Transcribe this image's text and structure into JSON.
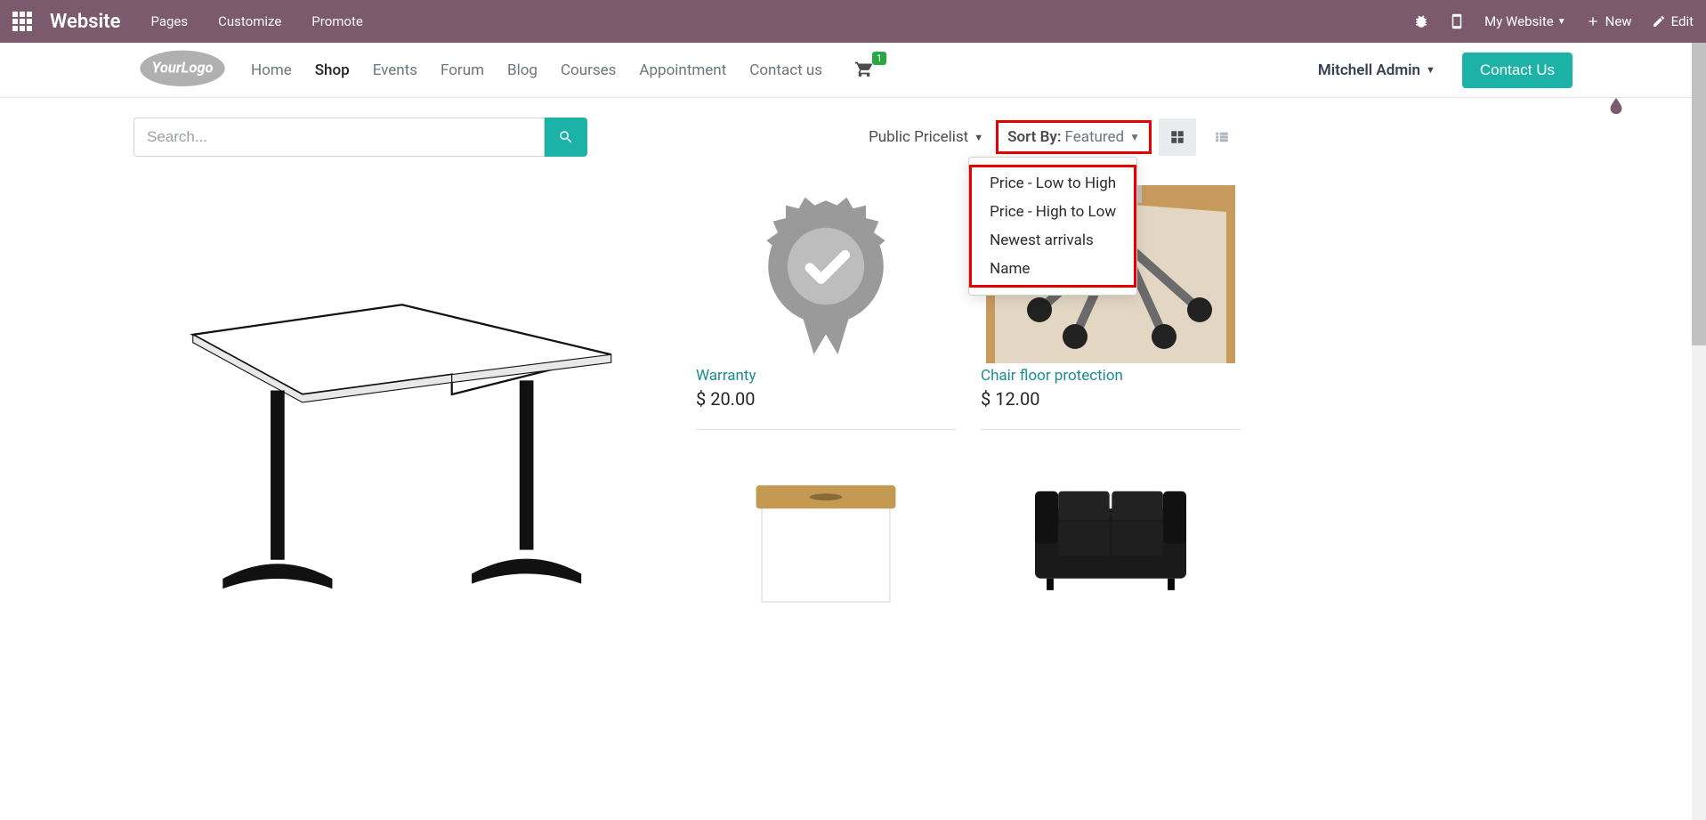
{
  "admin": {
    "brand": "Website",
    "menu": [
      "Pages",
      "Customize",
      "Promote"
    ],
    "website_switcher": "My Website",
    "new_label": "New",
    "edit_label": "Edit"
  },
  "nav": {
    "items": [
      {
        "label": "Home",
        "active": false
      },
      {
        "label": "Shop",
        "active": true
      },
      {
        "label": "Events",
        "active": false
      },
      {
        "label": "Forum",
        "active": false
      },
      {
        "label": "Blog",
        "active": false
      },
      {
        "label": "Courses",
        "active": false
      },
      {
        "label": "Appointment",
        "active": false
      },
      {
        "label": "Contact us",
        "active": false
      }
    ],
    "cart_count": "1",
    "user": "Mitchell Admin",
    "contact_btn": "Contact Us"
  },
  "shop": {
    "search_placeholder": "Search...",
    "pricelist": "Public Pricelist",
    "sort_label": "Sort By:",
    "sort_value": "Featured",
    "sort_options": [
      "Price - Low to High",
      "Price - High to Low",
      "Newest arrivals",
      "Name"
    ]
  },
  "products": {
    "p1": {
      "title": "Warranty",
      "price": "$ 20.00"
    },
    "p2": {
      "title": "Chair floor protection",
      "price": "$ 12.00"
    }
  },
  "colors": {
    "teal": "#1cb3a6",
    "plum": "#7b5a6e",
    "hl": "#e60000"
  }
}
